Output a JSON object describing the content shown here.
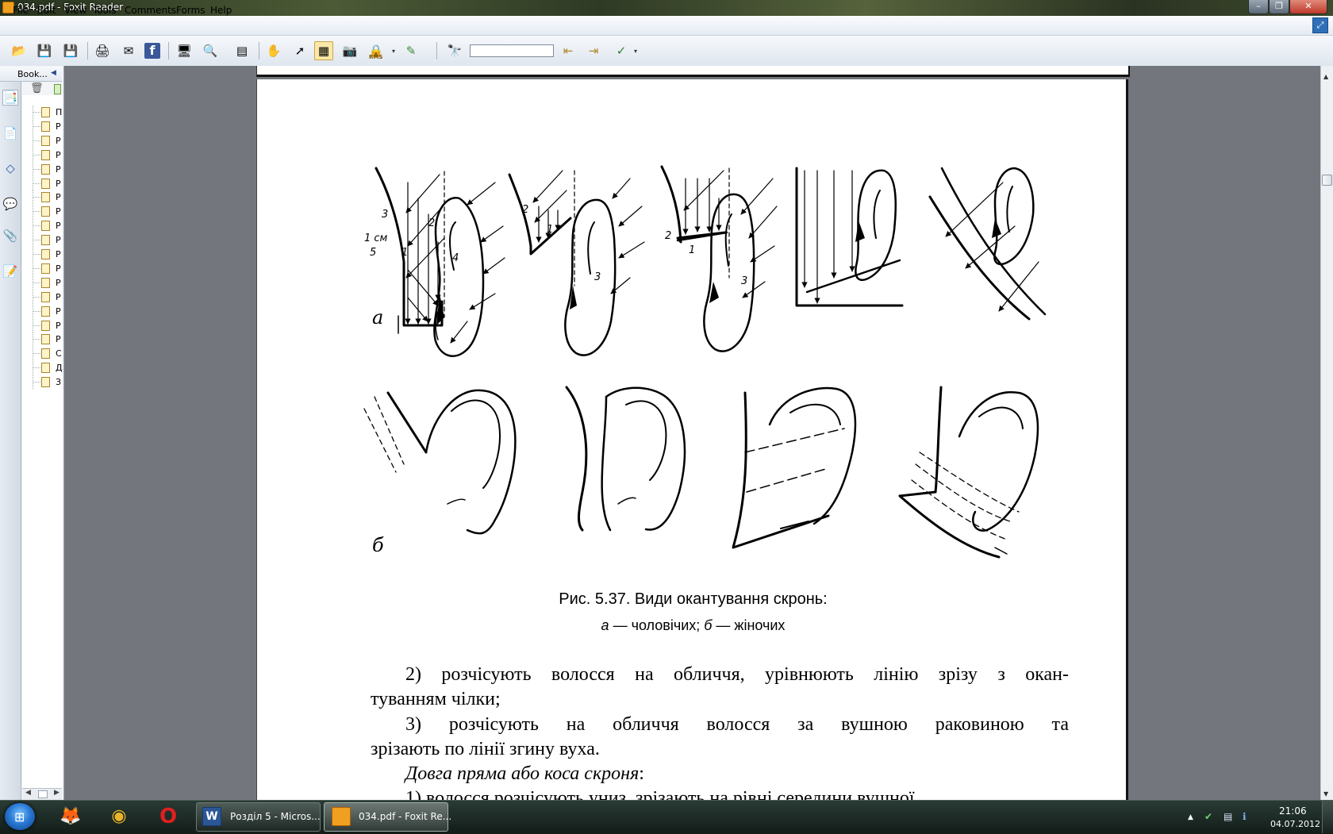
{
  "window": {
    "title": "034.pdf - Foxit Reader",
    "min_glyph": "–",
    "max_glyph": "❐",
    "close_glyph": "✕"
  },
  "menu": {
    "items": [
      "File",
      "Edit",
      "View",
      "Tools",
      "Comments",
      "Forms",
      "Help"
    ],
    "expand_glyph": "⤢"
  },
  "toolbar": {
    "icons": [
      {
        "name": "open-icon",
        "glyph": "📂"
      },
      {
        "name": "save-icon",
        "glyph": "💾"
      },
      {
        "name": "save-as-icon",
        "glyph": "💾"
      },
      {
        "name": "print-icon",
        "glyph": "🖨"
      },
      {
        "name": "email-icon",
        "glyph": "✉"
      },
      {
        "name": "facebook-icon",
        "glyph": "f"
      },
      {
        "name": "presentation-icon",
        "glyph": "🖥"
      },
      {
        "name": "loupe-icon",
        "glyph": "🔍"
      },
      {
        "name": "page-copy-icon",
        "glyph": "▤"
      },
      {
        "name": "hand-tool-icon",
        "glyph": "✋"
      },
      {
        "name": "select-tool-icon",
        "glyph": "➚"
      },
      {
        "name": "text-select-icon",
        "glyph": "▦"
      },
      {
        "name": "snapshot-icon",
        "glyph": "📷"
      },
      {
        "name": "rms-icon",
        "glyph": "🔒"
      },
      {
        "name": "sign-icon",
        "glyph": "✎"
      },
      {
        "name": "find-icon",
        "glyph": "🔭"
      },
      {
        "name": "find-prev-icon",
        "glyph": "⇤"
      },
      {
        "name": "find-next-icon",
        "glyph": "⇥"
      },
      {
        "name": "search-options-icon",
        "glyph": "✓"
      }
    ],
    "rms_label": "RMS"
  },
  "bookmarks": {
    "header": "Book...",
    "collapse_glyph": "◀",
    "delete_glyph": "🗑",
    "labels": [
      "П",
      "Р",
      "Р",
      "Р",
      "Р",
      "Р",
      "Р",
      "Р",
      "Р",
      "Р",
      "Р",
      "Р",
      "Р",
      "Р",
      "Р",
      "Р",
      "Р",
      "С",
      "Д",
      "З"
    ]
  },
  "nav": {
    "icons": [
      {
        "name": "bookmarks-panel-icon",
        "glyph": "📑"
      },
      {
        "name": "pages-panel-icon",
        "glyph": "📄"
      },
      {
        "name": "layers-panel-icon",
        "glyph": "◇"
      },
      {
        "name": "comments-panel-icon",
        "glyph": "💬"
      },
      {
        "name": "attachments-panel-icon",
        "glyph": "📎"
      },
      {
        "name": "signatures-panel-icon",
        "glyph": "📝"
      }
    ]
  },
  "document": {
    "fig_a_labels": {
      "n3": "3",
      "cm": "1 см",
      "n5": "5",
      "n1": "1",
      "n2": "2",
      "n4": "4",
      "p2_2": "2",
      "p2_1": "1",
      "p2_3": "3",
      "p3_2": "2",
      "p3_1": "1",
      "p3_3": "3"
    },
    "label_a": "а",
    "label_b": "б",
    "caption_main": "Рис. 5.37. Види окантування скронь:",
    "caption_sub_a": "а",
    "caption_sub_mid": " — чоловічих; ",
    "caption_sub_b": "б",
    "caption_sub_end": " — жіночих",
    "para1_l1": "2) розчісують волосся на обличчя, урівнюють лінію зрізу з окан-",
    "para1_l2": "туванням чілки;",
    "para2_l1": "3) розчісують на обличчя волосся за вушною раковиною та",
    "para2_l2": "зрізають по лінії згину вуха.",
    "heading_italic": "Довга пряма або коса скроня",
    "heading_colon": ":",
    "para3_partial": "1) волосся розчісують униз, зрізають на рівні середини вушної"
  },
  "taskbar": {
    "tasks": [
      {
        "label": "Розділ 5 - Micros...",
        "active": false
      },
      {
        "label": "034.pdf - Foxit Re...",
        "active": true
      }
    ],
    "quick": [
      {
        "name": "firefox-icon",
        "glyph": "🦊"
      },
      {
        "name": "chrome-icon",
        "glyph": "◉"
      },
      {
        "name": "opera-icon",
        "glyph": "O"
      }
    ],
    "tray_arrow": "▲",
    "tray_icons": [
      "✔",
      "▤",
      "ℹ"
    ],
    "time": "21:06",
    "date": "04.07.2012",
    "start_glyph": "⊞"
  },
  "colors": {
    "accent": "#2e6fb8",
    "page": "#ffffff",
    "doc_bg": "#73777d"
  }
}
